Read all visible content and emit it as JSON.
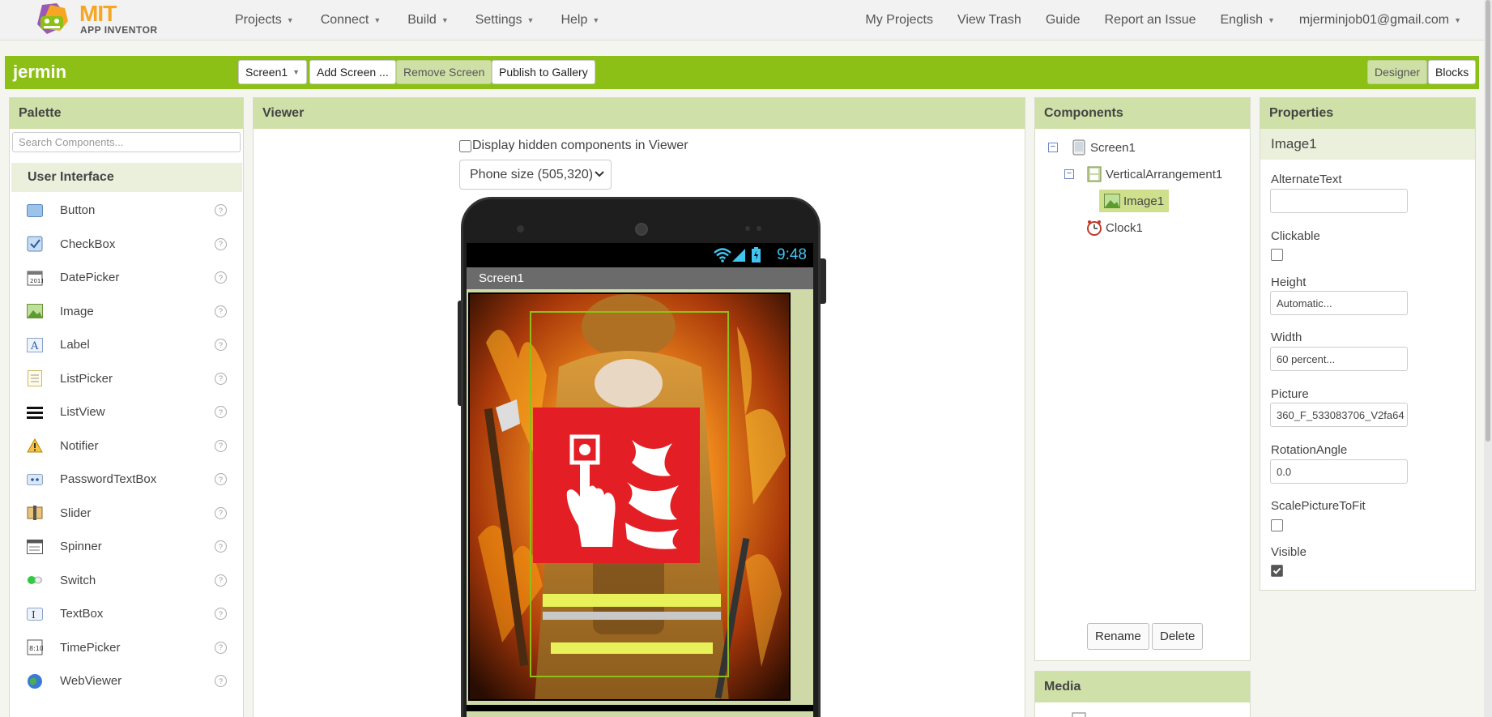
{
  "nav": {
    "logo_mit": "MIT",
    "logo_sub": "APP INVENTOR",
    "menus": [
      "Projects",
      "Connect",
      "Build",
      "Settings",
      "Help"
    ],
    "links": [
      "My Projects",
      "View Trash",
      "Guide",
      "Report an Issue"
    ],
    "language": "English",
    "account": "mjerminjob01@gmail.com"
  },
  "project": {
    "name": "jermin",
    "screen_select": "Screen1",
    "add_screen": "Add Screen ...",
    "remove_screen": "Remove Screen",
    "publish": "Publish to Gallery",
    "designer": "Designer",
    "blocks": "Blocks"
  },
  "palette": {
    "title": "Palette",
    "search_placeholder": "Search Components...",
    "category": "User Interface",
    "items": [
      {
        "label": "Button",
        "icon": "button-icon"
      },
      {
        "label": "CheckBox",
        "icon": "checkbox-icon"
      },
      {
        "label": "DatePicker",
        "icon": "datepicker-icon"
      },
      {
        "label": "Image",
        "icon": "image-icon"
      },
      {
        "label": "Label",
        "icon": "label-icon"
      },
      {
        "label": "ListPicker",
        "icon": "listpicker-icon"
      },
      {
        "label": "ListView",
        "icon": "listview-icon"
      },
      {
        "label": "Notifier",
        "icon": "notifier-icon"
      },
      {
        "label": "PasswordTextBox",
        "icon": "passwordtextbox-icon"
      },
      {
        "label": "Slider",
        "icon": "slider-icon"
      },
      {
        "label": "Spinner",
        "icon": "spinner-icon"
      },
      {
        "label": "Switch",
        "icon": "switch-icon"
      },
      {
        "label": "TextBox",
        "icon": "textbox-icon"
      },
      {
        "label": "TimePicker",
        "icon": "timepicker-icon"
      },
      {
        "label": "WebViewer",
        "icon": "webviewer-icon"
      }
    ],
    "help_glyph": "?"
  },
  "viewer": {
    "title": "Viewer",
    "hidden_label": "Display hidden components in Viewer",
    "hidden_checked": false,
    "size_option": "Phone size (505,320)",
    "phone_time": "9:48",
    "phone_screen_title": "Screen1"
  },
  "components": {
    "title": "Components",
    "tree": [
      "Screen1",
      "VerticalArrangement1",
      "Image1",
      "Clock1"
    ],
    "selected": "Image1",
    "rename": "Rename",
    "delete": "Delete"
  },
  "media": {
    "title": "Media"
  },
  "properties": {
    "title": "Properties",
    "component": "Image1",
    "alternate_text_label": "AlternateText",
    "alternate_text": "",
    "clickable_label": "Clickable",
    "clickable": false,
    "height_label": "Height",
    "height": "Automatic...",
    "width_label": "Width",
    "width": "60 percent...",
    "picture_label": "Picture",
    "picture": "360_F_533083706_V2fa64",
    "rotation_label": "RotationAngle",
    "rotation": "0.0",
    "scale_label": "ScalePictureToFit",
    "scale": false,
    "visible_label": "Visible",
    "visible": true
  },
  "colors": {
    "accent_green": "#8dc016",
    "panel_head": "#cfe0a8",
    "fire_sign_red": "#e31e24",
    "status_time_blue": "#43c3f0"
  }
}
